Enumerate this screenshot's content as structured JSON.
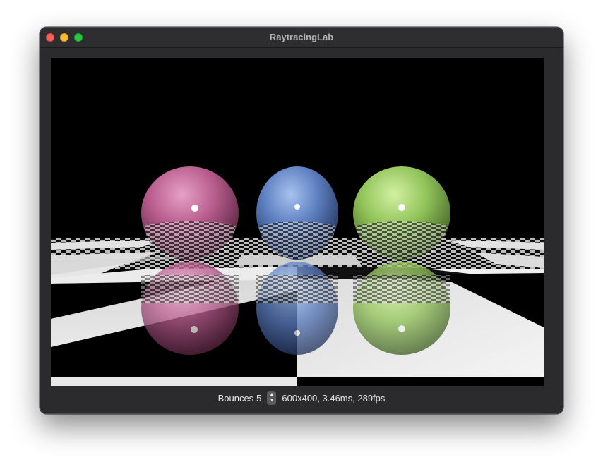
{
  "window": {
    "title": "RaytracingLab"
  },
  "controls": {
    "bounces_label": "Bounces",
    "bounces_value": "5",
    "stepper_up_icon": "chevron-up-icon",
    "stepper_down_icon": "chevron-down-icon"
  },
  "stats": {
    "text": "600x400, 3.46ms, 289fps"
  },
  "colors": {
    "sphere_left": "#c26a97",
    "sphere_middle": "#6b8fd0",
    "sphere_right": "#9ed064",
    "window_bg": "#2b2b2d",
    "viewport_bg": "#000000"
  }
}
